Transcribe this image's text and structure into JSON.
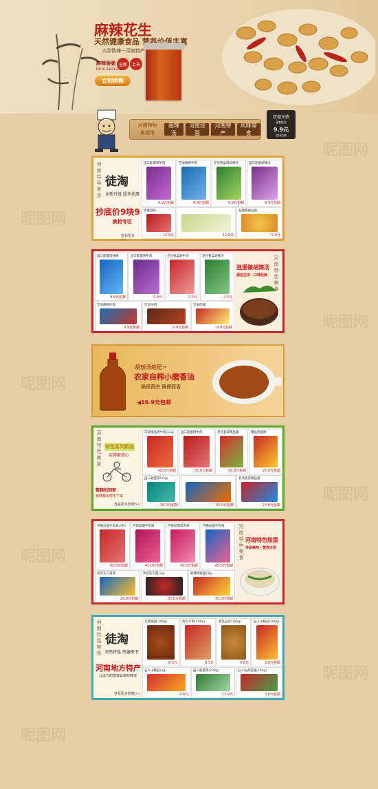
{
  "banner": {
    "title": "麻辣花生",
    "subtitle": "天然健康食品 营养价值丰富",
    "tagline": "大梁情神一河南特产",
    "tag_label": "麻辣香脆",
    "badge1": "全新",
    "badge2": "上市",
    "new_arrival": "NEW ARRIVAL",
    "buy_button": "立刻抢购"
  },
  "nav": {
    "logo_line1": "河南特色",
    "logo_line2": "美食馆",
    "items": [
      "胡辣汤",
      "河南烩面",
      "河南特产",
      "风味零食"
    ],
    "board_title": "欢迎光临",
    "board_sub": "速食批发",
    "board_price": "9.9元",
    "board_foot": "全场包邮"
  },
  "sections": [
    {
      "vertical": "河南特色美食",
      "brand": "徒淘",
      "slogan": "全新升级 超多优惠",
      "promo": "抄底价9块9",
      "promo_sub": "疯抢专区",
      "more": "查看更多>>",
      "cells": [
        {
          "name": "国三能量牌牛肉",
          "price": "9.9元包邮"
        },
        {
          "name": "京溢麻辣牛肉",
          "price": "9.9元包邮"
        },
        {
          "name": "老热香菜牌胡辣汤",
          "price": "9.9元包邮"
        },
        {
          "name": "国三能量胡辣汤",
          "price": "9.9元包邮"
        },
        {
          "name": "周嘉酒味",
          "price": "12.9元"
        },
        {
          "name": "",
          "price": "12.9元"
        },
        {
          "name": "石磨香辣豆腐",
          "price": "9.9元"
        }
      ]
    },
    {
      "vertical": "河南特色美食",
      "promo": "逍遥镇胡辣汤",
      "promo_sub": "源自正宗・口味经典",
      "cells": [
        {
          "name": "国三能量牌胡辣",
          "price": "9.9元包邮"
        },
        {
          "name": "国三能量牌牛肉",
          "price": "9.6元"
        },
        {
          "name": "老热香菜牌牛肉",
          "price": "2.5元"
        },
        {
          "name": "老热香菜胡辣汤",
          "price": "2.5元"
        },
        {
          "name": "京溢麻辣牛肉",
          "price": "9.9元包邮"
        },
        {
          "name": "京溢牛肉",
          "price": "9.9元包邮"
        },
        {
          "name": "京溢肉脯",
          "price": "9.9元包邮"
        }
      ]
    },
    {
      "title1": "胡辣汤绝配>",
      "title2": "农家自榨小磨香油",
      "slogan": "确保真宗 确保醇香",
      "price": "16.9元包邮"
    },
    {
      "vertical": "河南特色美食",
      "promo": "特色系列新品",
      "promo_sub": "买得更放心",
      "promo2": "整箱拍回家",
      "promo3": "美味根本停不下来",
      "more": "查看更多数箱>>",
      "cells": [
        {
          "name": "京溢精品牌牛肉(11g)",
          "price": "46.8元包邮"
        },
        {
          "name": "国三能量牌牛肉",
          "price": "35.0元包邮"
        },
        {
          "name": "老热香菜精品箱",
          "price": "58.0元包邮"
        },
        {
          "name": "精品老宴牌",
          "price": "25.0元包邮"
        },
        {
          "name": "国三能量牌(32g)",
          "price": "35.0元包邮"
        },
        {
          "name": "",
          "price": "35.0元包邮"
        },
        {
          "name": "老热香菜精品箱",
          "price": "24.8元包邮"
        }
      ]
    },
    {
      "vertical": "河南特色美食",
      "promo": "河南特色烩面",
      "promo_sub": "传承美味・营养正宗",
      "cells": [
        {
          "name": "河南烩面牛肉味(3包)",
          "price": "45.0元包邮"
        },
        {
          "name": "河南烩面牛肉味",
          "price": "45.0元包邮"
        },
        {
          "name": "河南烩面羊肉味",
          "price": "45.0元包邮"
        },
        {
          "name": "河南烩面牛肉味",
          "price": "45.0元包邮"
        },
        {
          "name": "冥郊东方香牌",
          "price": "26.0元包邮"
        },
        {
          "name": "冥灵陈干面(3g)",
          "price": "35.0元包邮"
        },
        {
          "name": "麻辣烧烩面(3g)",
          "price": "35.0元包邮"
        }
      ]
    },
    {
      "vertical": "河南特色美食",
      "brand": "徒淘",
      "slogan": "河南特色 传遍天下",
      "promo": "河南地方特产",
      "promo_sub": "让远方的您体会家的味道",
      "more": "查看更多数箱>>",
      "cells": [
        {
          "name": "马西果面(300g)",
          "price": "8.5元"
        },
        {
          "name": "南方大枣(200g)",
          "price": "8.5元"
        },
        {
          "name": "麦乳豆浆(100g)",
          "price": "9.8元"
        },
        {
          "name": "石人山精品(100g)",
          "price": "3.8元包邮"
        },
        {
          "name": "石人山精品(3g)",
          "price": "4.8元"
        },
        {
          "name": "国三能量牌(200g)",
          "price": "12.9元"
        },
        {
          "name": "石人山香菇酱(100g)",
          "price": "3.8元包邮"
        }
      ]
    }
  ],
  "watermark": "昵图网"
}
